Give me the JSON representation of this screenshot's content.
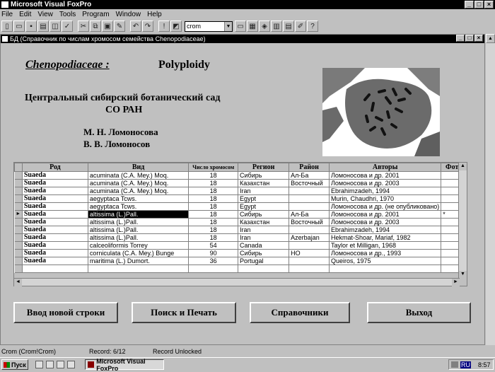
{
  "app": {
    "title": "Microsoft Visual FoxPro",
    "menu": [
      "File",
      "Edit",
      "View",
      "Tools",
      "Program",
      "Window",
      "Help"
    ],
    "toolbar_combo_value": "crom"
  },
  "form": {
    "title": "БД (Справочник по числам хромосом семейства Chenopodiaceae)",
    "family": "Chenopodiaceae :",
    "subtitle": "Polyploidy",
    "institution_line1": "Центральный сибирский ботанический сад",
    "institution_line2": "СО РАН",
    "author1": "М. Н. Ломоносова",
    "author2": "В. В. Ломоносов"
  },
  "grid": {
    "columns": [
      "Род",
      "Вид",
      "Число хромосом",
      "Регион",
      "Район",
      "Авторы",
      "Фото"
    ],
    "current_row": 5,
    "rows": [
      [
        "Suaeda",
        "acuminata (C.A. Mey.) Moq.",
        "18",
        "Сибирь",
        "Ал-Ба",
        "Ломоносова и др. 2001",
        ""
      ],
      [
        "Suaeda",
        "acuminata (C.A. Mey.) Moq.",
        "18",
        "Казахстан",
        "Восточный",
        "Ломоносова и др. 2003",
        ""
      ],
      [
        "Suaeda",
        "acuminata (C.A. Mey.) Moq.",
        "18",
        "Iran",
        "",
        "Ebrahimzadeh, 1994",
        ""
      ],
      [
        "Suaeda",
        "aegyptaca Tcws.",
        "18",
        "Egypt",
        "",
        "Murin, Chaudhri, 1970",
        ""
      ],
      [
        "Suaeda",
        "aegyptaca Tcws.",
        "18",
        "Egypt",
        "",
        "Ломоносова и др. (не опубликовано)",
        ""
      ],
      [
        "Suaeda",
        "altissima (L.)Pall.",
        "18",
        "Сибирь",
        "Ал-Ба",
        "Ломоносова и др. 2001",
        "*"
      ],
      [
        "Suaeda",
        "altissima (L.)Pall.",
        "18",
        "Казахстан",
        "Восточный",
        "Ломоносова и др. 2003",
        ""
      ],
      [
        "Suaeda",
        "altissima (L.)Pall.",
        "18",
        "Iran",
        "",
        "Ebrahimzadeh, 1994",
        ""
      ],
      [
        "Suaeda",
        "altissima (L.)Pall.",
        "18",
        "Iran",
        "Azerbajan",
        "Hekmat-Shoar, Mariaf, 1982",
        ""
      ],
      [
        "Suaeda",
        "calceoliformis Torrey",
        "54",
        "Canada",
        "",
        "Taylor et Milligan, 1968",
        ""
      ],
      [
        "Suaeda",
        "corniculata (C.A. Mey.) Bunge",
        "90",
        "Сибирь",
        "НО",
        "Ломоносова и др., 1993",
        ""
      ],
      [
        "Suaeda",
        "maritima (L.) Dumort.",
        "36",
        "Portugal",
        "",
        "Queiros, 1975",
        ""
      ]
    ]
  },
  "buttons": {
    "new_row": "Ввод новой строки",
    "search_print": "Поиск и Печать",
    "references": "Справочники",
    "exit": "Выход"
  },
  "status": {
    "table": "Crom (Crom!Crom)",
    "record": "Record: 6/12",
    "lock": "Record Unlocked"
  },
  "taskbar": {
    "start": "Пуск",
    "task": "Microsoft Visual FoxPro",
    "lang": "RU",
    "time": "8:57"
  }
}
